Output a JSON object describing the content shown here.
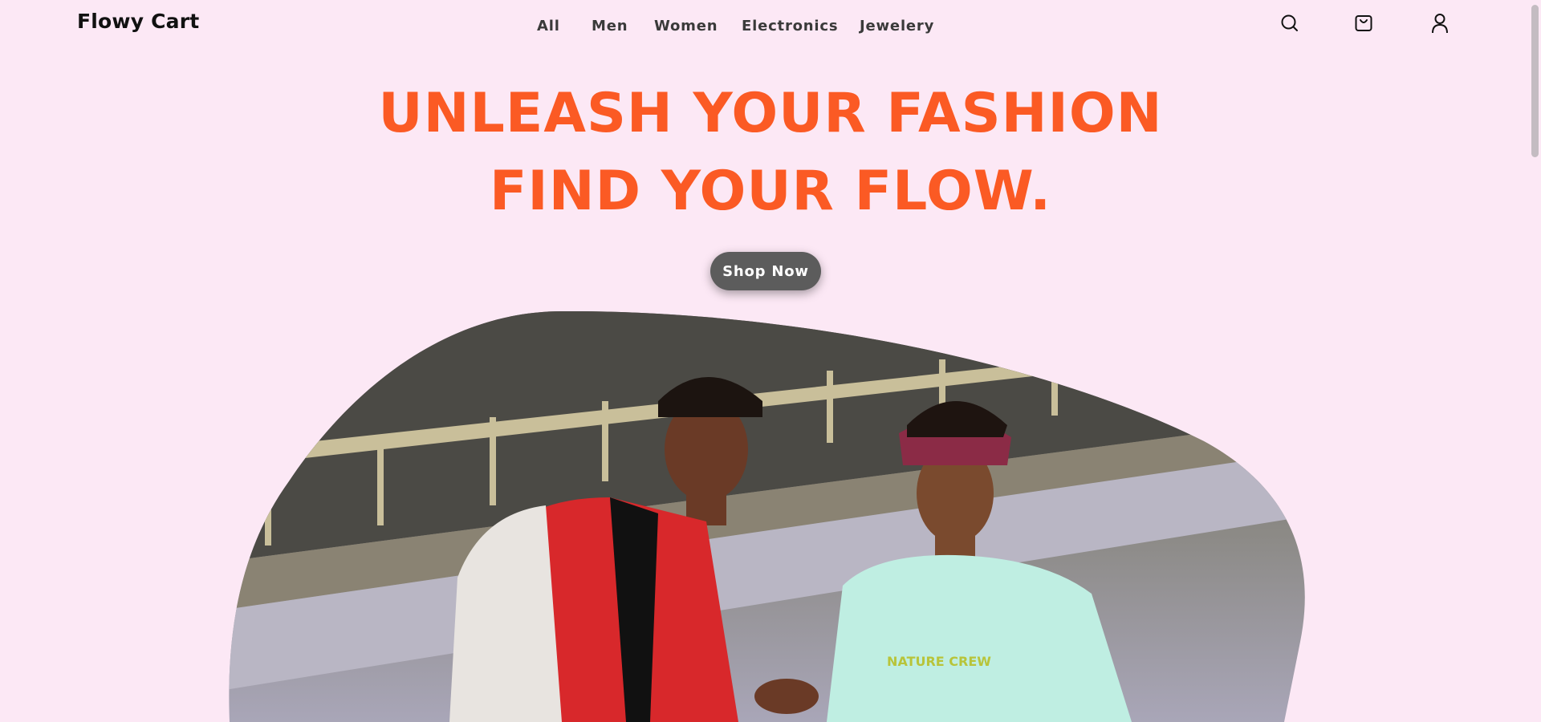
{
  "header": {
    "logo": "Flowy Cart",
    "nav": [
      "All",
      "Men",
      "Women",
      "Electronics",
      "Jewelery"
    ],
    "icons": [
      "search-icon",
      "cart-icon",
      "user-icon"
    ]
  },
  "hero": {
    "headline_line1": "UNLEASH YOUR FASHION",
    "headline_line2": "FIND YOUR FLOW.",
    "cta_label": "Shop Now",
    "image_shirt_text": "NATURE CREW"
  },
  "colors": {
    "background": "#fce8f5",
    "accent": "#fb5a24",
    "button": "#5c5c5c",
    "text": "#3a3a3a"
  }
}
